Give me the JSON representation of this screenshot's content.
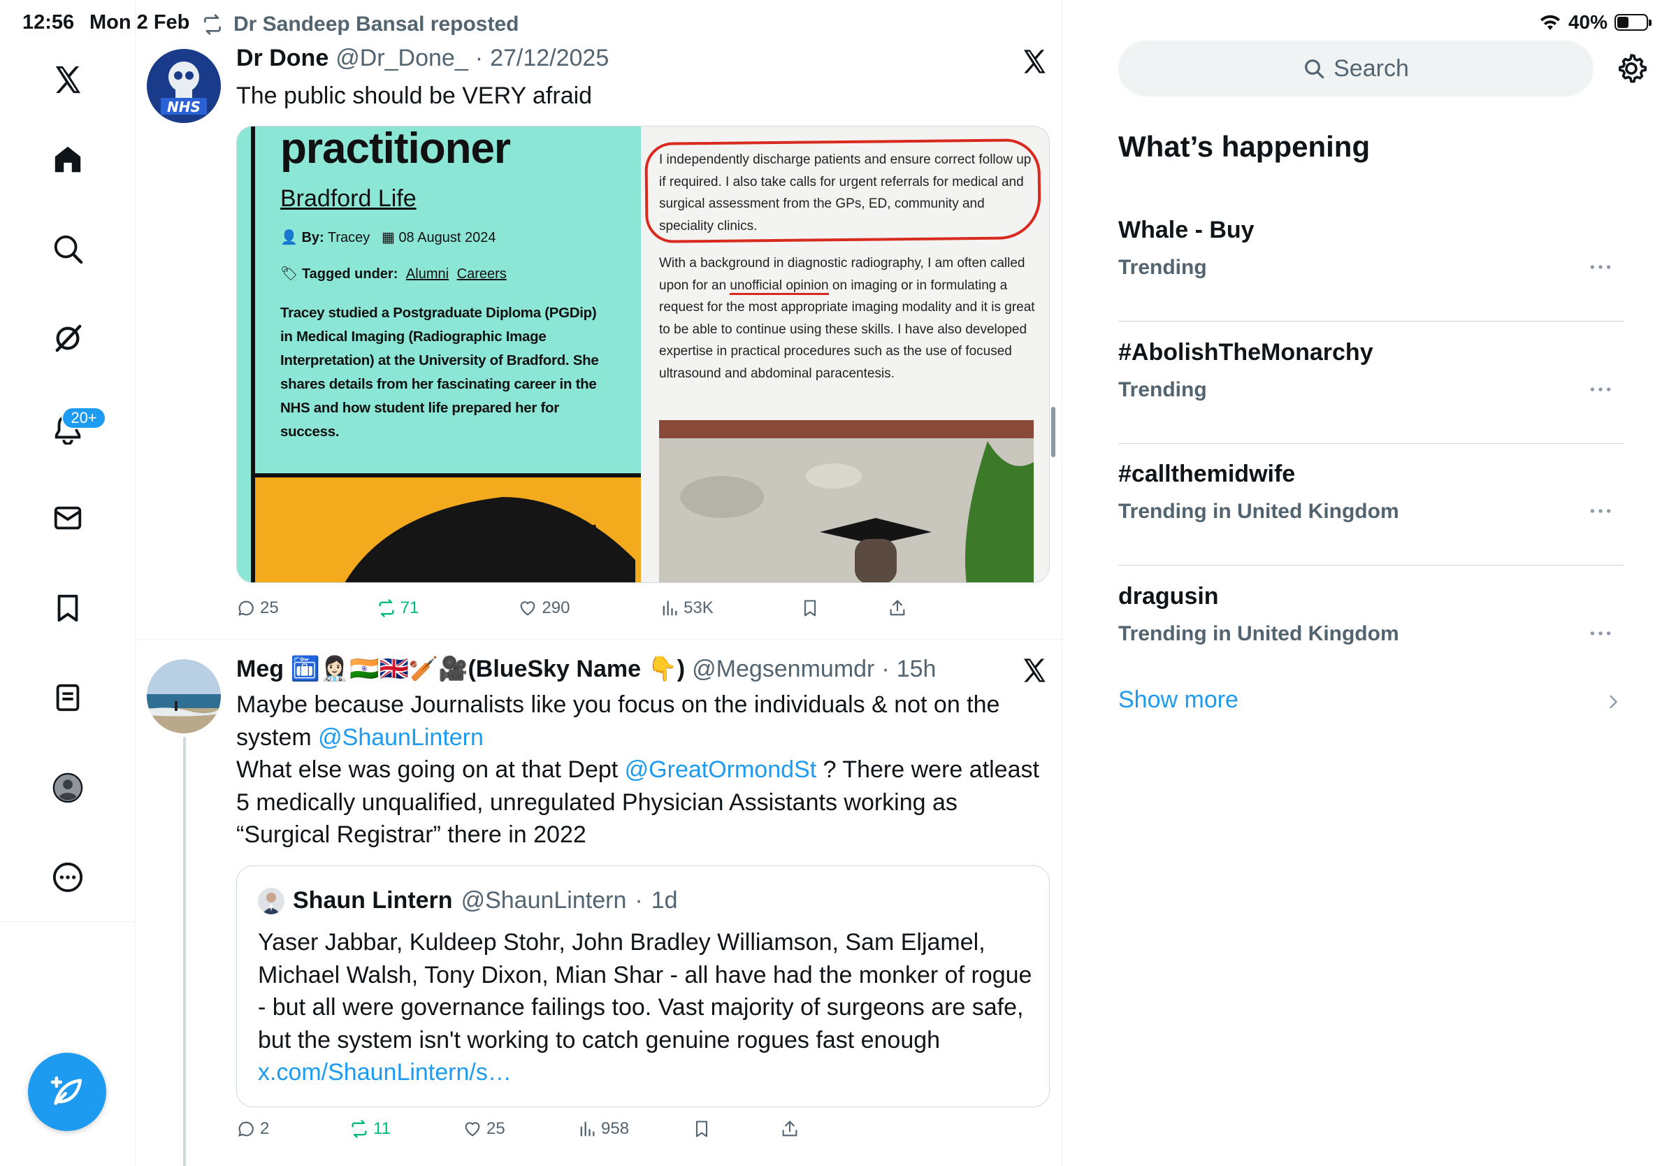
{
  "status_bar": {
    "time": "12:56",
    "date": "Mon 2 Feb",
    "battery": "40%",
    "battery_level": 0.4
  },
  "nav": {
    "items": [
      "x-logo",
      "home",
      "explore",
      "grok",
      "notifications",
      "messages",
      "bookmarks",
      "lists",
      "profile",
      "more"
    ],
    "notification_badge": "20+"
  },
  "feed": {
    "tweet1": {
      "repost_label": "Dr Sandeep Bansal reposted",
      "name": "Dr Done",
      "handle": "@Dr_Done_",
      "dot": "·",
      "date": "27/12/2025",
      "text": "The public should be VERY afraid",
      "media": {
        "title": "practitioner",
        "subtitle": "Bradford Life",
        "by_label": "By:",
        "by_value": "Tracey",
        "date": "08 August 2024",
        "tagged_label": "Tagged under:",
        "tag1": "Alumni",
        "tag2": "Careers",
        "body": "Tracey studied a Postgraduate Diploma (PGDip) in Medical Imaging (Radiographic Image Interpretation) at the University of Bradford. She shares details from her fascinating career in the NHS and how student life prepared her for success.",
        "right_text1": "I independently discharge patients and ensure correct follow up if required.  I also take calls for urgent referrals for medical and surgical assessment from the GPs, ED, community and speciality clinics.",
        "right_text2_a": "With a background in diagnostic radiography, I am often called upon for an ",
        "right_text2_underlined": "unofficial opinion",
        "right_text2_b": " on imaging or in formulating a request for the most appropriate imaging modality and it is great to be able to continue using these skills. I have also developed expertise in practical procedures such as the use of focused ultrasound and abdominal paracentesis."
      },
      "actions": {
        "replies": "25",
        "reposts": "71",
        "likes": "290",
        "views": "53K"
      }
    },
    "tweet2": {
      "name": "Meg 🛅👩🏻‍⚕️🇮🇳🇬🇧🏏🎥(BlueSky Name 👇)",
      "handle": "@Megsenmumdr",
      "dot": "·",
      "time": "15h",
      "text_1": "Maybe because Journalists like you focus on the individuals & not on the system ",
      "mention_1": "@ShaunLintern",
      "text_2": "What else was going on at that Dept ",
      "mention_2": "@GreatOrmondSt",
      "text_3": " ? There were atleast 5 medically unqualified, unregulated Physician Assistants working as “Surgical Registrar” there in 2022",
      "quote": {
        "name": "Shaun Lintern",
        "handle": "@ShaunLintern",
        "dot": "·",
        "time": "1d",
        "text": "Yaser Jabbar, Kuldeep Stohr, John Bradley Williamson, Sam Eljamel, Michael Walsh, Tony Dixon, Mian Shar - all have had the monker of rogue - but all were governance failings too. Vast majority of surgeons are safe, but the system isn't working to catch genuine rogues fast enough ",
        "link": "x.com/ShaunLintern/s…"
      },
      "actions": {
        "replies": "2",
        "reposts": "11",
        "likes": "25",
        "views": "958"
      }
    }
  },
  "sidebar": {
    "search_placeholder": "Search",
    "title": "What’s happening",
    "trends": [
      {
        "name": "Whale - Buy",
        "context": "Trending"
      },
      {
        "name": "#AbolishTheMonarchy",
        "context": "Trending"
      },
      {
        "name": "#callthemidwife",
        "context": "Trending in United Kingdom"
      },
      {
        "name": "dragusin",
        "context": "Trending in United Kingdom"
      }
    ],
    "show_more": "Show more"
  },
  "colors": {
    "accent": "#1d9bf0",
    "repost_green": "#00ba7c",
    "muted": "#536471",
    "teal_card": "#8ce6d6",
    "orange_card": "#f3aa1c",
    "annotation_red": "#d92a1f"
  }
}
